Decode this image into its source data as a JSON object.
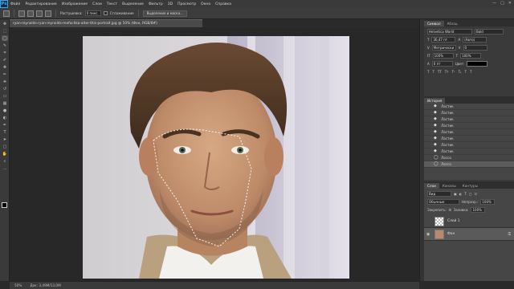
{
  "menubar": {
    "logo": "Ps",
    "items": [
      "Файл",
      "Редактирование",
      "Изображение",
      "Слои",
      "Текст",
      "Выделение",
      "Фильтр",
      "3D",
      "Просмотр",
      "Окно",
      "Справка"
    ],
    "window_controls": [
      "—",
      "□",
      "✕"
    ]
  },
  "options_bar": {
    "feather_label": "Растушевка:",
    "feather_value": "0 пикс.",
    "antialias_label": "Сглаживание",
    "refine_button": "Выделение и маска..."
  },
  "document": {
    "tab_title": "ryan-reynolds-ryan-reynolds-mefochka-alter-this-portrait.jpg @ 50% (Фон, RGB/8#)"
  },
  "status": {
    "zoom": "50%",
    "doc_size": "Док: 3,49M/13,0M"
  },
  "character_panel": {
    "tabs": [
      "Символ",
      "Абзац"
    ],
    "font_family": "Helvetica World",
    "font_style": "Bold",
    "size": "36,47 пт",
    "leading": "(Авто)",
    "tracking_label": "Метрически",
    "tracking_value": "0",
    "vscale": "100%",
    "hscale": "100%",
    "baseline": "0 пт",
    "color_label": "Цвет:"
  },
  "history_panel": {
    "title": "История",
    "items": [
      "Ластик",
      "Ластик",
      "Ластик",
      "Ластик",
      "Ластик",
      "Ластик",
      "Ластик",
      "Ластик",
      "Лассо",
      "Лассо"
    ]
  },
  "layers_panel": {
    "tabs": [
      "Слои",
      "Каналы",
      "Контуры"
    ],
    "kind_label": "Вид",
    "blend_mode": "Обычные",
    "opacity_label": "Непрозр.:",
    "opacity_value": "100%",
    "lock_label": "Закрепить:",
    "fill_label": "Заливка:",
    "fill_value": "100%",
    "layers": [
      {
        "name": "Слой 1"
      },
      {
        "name": "Фон"
      }
    ]
  }
}
